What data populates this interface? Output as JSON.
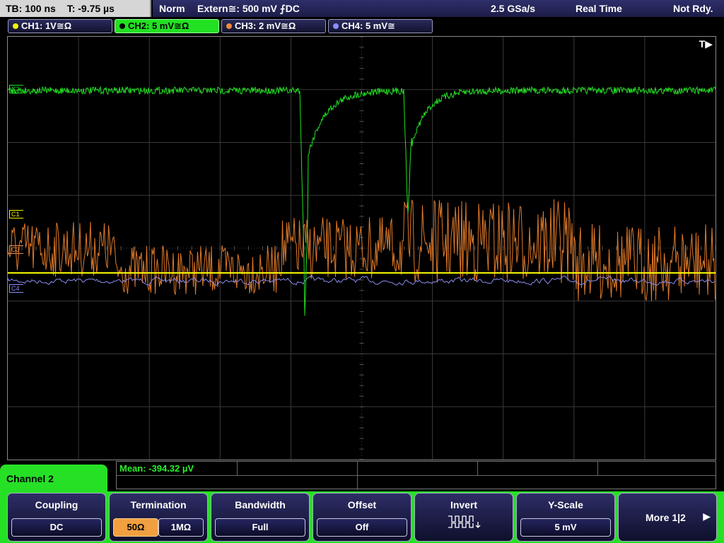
{
  "topbar": {
    "timebase": "TB: 100 ns",
    "trigger_time": "T: -9.75 µs",
    "mode": "Norm",
    "trigger_source": "Extern≅: 500 mV ⨍DC",
    "sample_rate": "2.5 GSa/s",
    "acq_mode": "Real Time",
    "status": "Not Rdy."
  },
  "channels": [
    {
      "label": "CH1: 1V≅Ω",
      "color": "#f4f400"
    },
    {
      "label": "CH2: 5 mV≅Ω",
      "color": "#22e022"
    },
    {
      "label": "CH3: 2 mV≅Ω",
      "color": "#f08a3a"
    },
    {
      "label": "CH4: 5 mV≅",
      "color": "#8c8cff"
    }
  ],
  "screen": {
    "trigger_flag": "T▶",
    "markers": {
      "c1": "C1",
      "c3": "C3",
      "c4": "C4",
      "c2": "C2"
    },
    "colors": {
      "grid": "#3a3a3a",
      "ch1": "#f4f400",
      "ch2": "#22e022",
      "ch3": "#e07a2a",
      "ch4": "#8a8aee"
    }
  },
  "measurement": {
    "mean": "Mean: -394.32 µV"
  },
  "menu": {
    "title": "Channel 2",
    "coupling_label": "Coupling",
    "coupling_value": "DC",
    "termination_label": "Termination",
    "termination_opt1": "50Ω",
    "termination_opt2": "1MΩ",
    "bandwidth_label": "Bandwidth",
    "bandwidth_value": "Full",
    "offset_label": "Offset",
    "offset_value": "Off",
    "invert_label": "Invert",
    "yscale_label": "Y-Scale",
    "yscale_value": "5 mV",
    "more_label": "More 1|2",
    "more_arrow": "▶"
  }
}
